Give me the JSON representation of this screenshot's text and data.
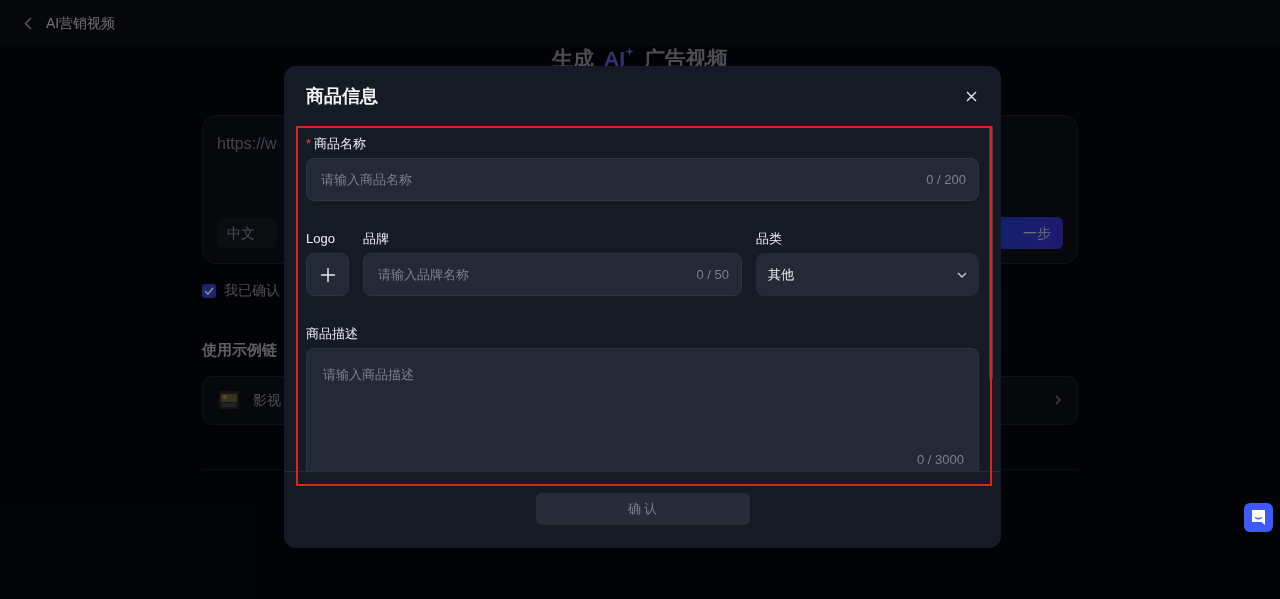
{
  "header": {
    "back_label": "AI营销视频"
  },
  "page": {
    "title_parts": [
      "生成",
      "AI",
      "广告视频"
    ],
    "url_input": {
      "value": "https://w"
    },
    "language_select": {
      "value": "中文"
    },
    "next_button": "一步",
    "consent": {
      "label": "我已确认",
      "checked": true
    },
    "examples_heading": "使用示例链",
    "examples": [
      {
        "label": "影视"
      }
    ]
  },
  "dialog": {
    "title": "商品信息",
    "name_field": {
      "required_mark": "*",
      "label": "商品名称",
      "placeholder": "请输入商品名称",
      "counter": "0 / 200"
    },
    "logo_field": {
      "label": "Logo"
    },
    "brand_field": {
      "label": "品牌",
      "placeholder": "请输入品牌名称",
      "counter": "0 / 50"
    },
    "category_field": {
      "label": "品类",
      "value": "其他"
    },
    "description_field": {
      "label": "商品描述",
      "placeholder": "请输入商品描述",
      "counter": "0 / 3000"
    },
    "confirm_button": {
      "label": "确 认",
      "disabled": true
    }
  }
}
